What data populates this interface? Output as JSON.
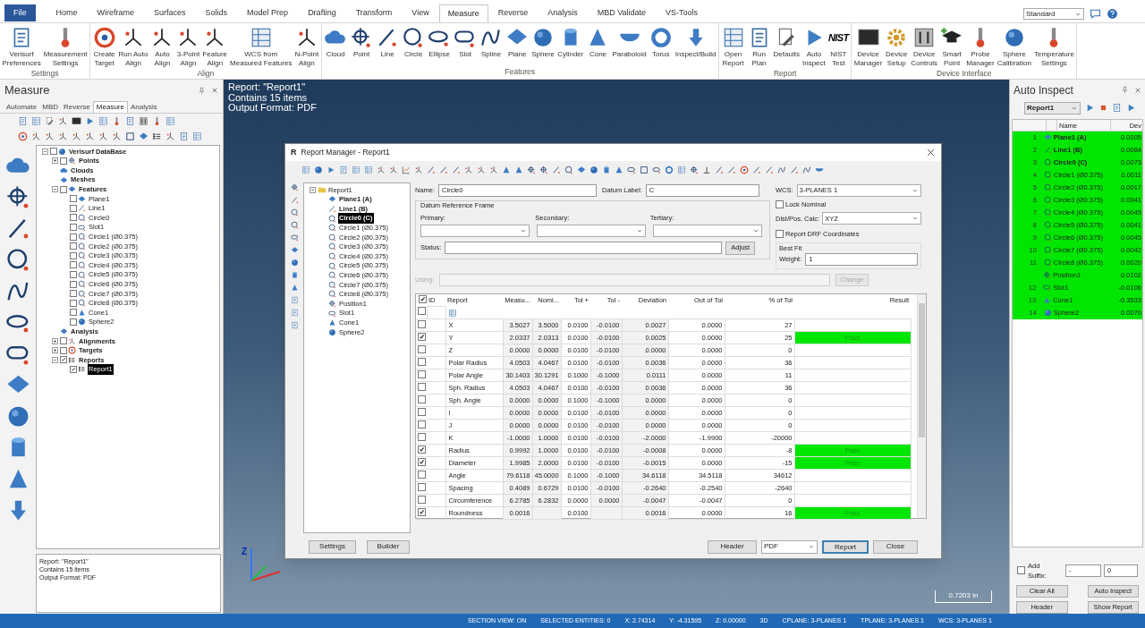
{
  "ribbon_tabs": [
    {
      "label": "File",
      "kind": "file",
      "selected": false
    },
    {
      "label": "Home",
      "kind": "tab",
      "selected": false
    },
    {
      "label": "Wireframe",
      "kind": "tab",
      "selected": false
    },
    {
      "label": "Surfaces",
      "kind": "tab",
      "selected": false
    },
    {
      "label": "Solids",
      "kind": "tab",
      "selected": false
    },
    {
      "label": "Model Prep",
      "kind": "tab",
      "selected": false
    },
    {
      "label": "Drafting",
      "kind": "tab",
      "selected": false
    },
    {
      "label": "Transform",
      "kind": "tab",
      "selected": false
    },
    {
      "label": "View",
      "kind": "tab",
      "selected": false
    },
    {
      "label": "Measure",
      "kind": "tab",
      "selected": true
    },
    {
      "label": "Reverse",
      "kind": "tab",
      "selected": false
    },
    {
      "label": "Analysis",
      "kind": "tab",
      "selected": false
    },
    {
      "label": "MBD Validate",
      "kind": "tab",
      "selected": false
    },
    {
      "label": "VS-Tools",
      "kind": "tab",
      "selected": false
    }
  ],
  "style_select": {
    "value": "Standard"
  },
  "ribbon_groups": [
    {
      "label": "Settings",
      "buttons": [
        {
          "label": "Verisurf\nPreferences"
        },
        {
          "label": "Measurement\nSettings"
        }
      ]
    },
    {
      "label": "Align",
      "buttons": [
        {
          "label": "Create\nTarget"
        },
        {
          "label": "Run Auto\nAlign"
        },
        {
          "label": "Auto\nAlign"
        },
        {
          "label": "3-Point\nAlign"
        },
        {
          "label": "Feature\nAlign"
        },
        {
          "label": "WCS from\nMeasured Features"
        },
        {
          "label": "N-Point\nAlign"
        }
      ]
    },
    {
      "label": "Features",
      "buttons": [
        {
          "label": "Cloud"
        },
        {
          "label": "Point"
        },
        {
          "label": "Line"
        },
        {
          "label": "Circle"
        },
        {
          "label": "Ellipse"
        },
        {
          "label": "Slot"
        },
        {
          "label": "Spline"
        },
        {
          "label": "Plane"
        },
        {
          "label": "Sphere"
        },
        {
          "label": "Cylinder"
        },
        {
          "label": "Cone"
        },
        {
          "label": "Paraboloid"
        },
        {
          "label": "Torus"
        },
        {
          "label": "Inspect/Build"
        }
      ]
    },
    {
      "label": "Report",
      "buttons": [
        {
          "label": "Open\nReport"
        },
        {
          "label": "Run\nPlan"
        },
        {
          "label": "Defaults"
        },
        {
          "label": "Auto\nInspect"
        },
        {
          "label": "NIST\nTest",
          "icon_text": "NIST"
        }
      ]
    },
    {
      "label": "Device Interface",
      "buttons": [
        {
          "label": "Device\nManager"
        },
        {
          "label": "Device\nSetup"
        },
        {
          "label": "Device\nControls"
        },
        {
          "label": "Smart\nPoint"
        },
        {
          "label": "Probe\nManager"
        },
        {
          "label": "Sphere\nCalibration"
        },
        {
          "label": "Temperature\nSettings"
        }
      ]
    }
  ],
  "measure_panel": {
    "title": "Measure",
    "tabs": [
      {
        "label": "Automate",
        "selected": false
      },
      {
        "label": "MBD",
        "selected": false
      },
      {
        "label": "Reverse",
        "selected": false
      },
      {
        "label": "Measure",
        "selected": true
      },
      {
        "label": "Analysis",
        "selected": false
      }
    ],
    "tree": [
      {
        "label": "Verisurf DataBase",
        "expanded": true,
        "checked": false,
        "selected": false,
        "children": [
          {
            "label": "Points",
            "expanded": false,
            "checked": false,
            "selected": false
          },
          {
            "label": "Clouds",
            "selected": false
          },
          {
            "label": "Meshes",
            "selected": false
          },
          {
            "label": "Features",
            "expanded": true,
            "checked": false,
            "selected": false,
            "children": [
              {
                "label": "Plane1",
                "checked": false,
                "selected": false
              },
              {
                "label": "Line1",
                "checked": false,
                "selected": false
              },
              {
                "label": "Circle0",
                "checked": false,
                "selected": false
              },
              {
                "label": "Slot1",
                "checked": false,
                "selected": false
              },
              {
                "label": "Circle1 (Ø0.375)",
                "checked": false,
                "selected": false
              },
              {
                "label": "Circle2 (Ø0.375)",
                "checked": false,
                "selected": false
              },
              {
                "label": "Circle3 (Ø0.375)",
                "checked": false,
                "selected": false
              },
              {
                "label": "Circle4 (Ø0.375)",
                "checked": false,
                "selected": false
              },
              {
                "label": "Circle5 (Ø0.375)",
                "checked": false,
                "selected": false
              },
              {
                "label": "Circle6 (Ø0.375)",
                "checked": false,
                "selected": false
              },
              {
                "label": "Circle7 (Ø0.375)",
                "checked": false,
                "selected": false
              },
              {
                "label": "Circle8 (Ø0.375)",
                "checked": false,
                "selected": false
              },
              {
                "label": "Cone1",
                "checked": false,
                "selected": false
              },
              {
                "label": "Sphere2",
                "checked": false,
                "selected": false
              }
            ]
          },
          {
            "label": "Analysis",
            "selected": false
          },
          {
            "label": "Alignments",
            "expanded": false,
            "checked": false,
            "selected": false
          },
          {
            "label": "Targets",
            "expanded": false,
            "checked": false,
            "selected": false
          },
          {
            "label": "Reports",
            "expanded": true,
            "checked": true,
            "selected": false,
            "children": [
              {
                "label": "Report1",
                "checked": true,
                "selected": true
              }
            ]
          }
        ]
      }
    ],
    "info": [
      "Report: \"Report1\"",
      "Contains 15 items",
      "Output Format: PDF"
    ]
  },
  "viewport": {
    "info": [
      "Report: \"Report1\"",
      "Contains 15 items",
      "Output Format: PDF"
    ],
    "triad_label": "Z",
    "scale": "0.7203 in"
  },
  "report_manager": {
    "title": "Report Manager - Report1",
    "logo": "R",
    "tree": {
      "label": "Report1",
      "expanded": true,
      "children": [
        {
          "label": "Plane1 (A)",
          "datum": true,
          "selected": false
        },
        {
          "label": "Line1 (B)",
          "datum": true,
          "selected": false
        },
        {
          "label": "Circle0 (C)",
          "datum": true,
          "selected": true
        },
        {
          "label": "Circle1 (Ø0.375)",
          "datum": false,
          "selected": false
        },
        {
          "label": "Circle2 (Ø0.375)",
          "datum": false,
          "selected": false
        },
        {
          "label": "Circle3 (Ø0.375)",
          "datum": false,
          "selected": false
        },
        {
          "label": "Circle4 (Ø0.375)",
          "datum": false,
          "selected": false
        },
        {
          "label": "Circle5 (Ø0.375)",
          "datum": false,
          "selected": false
        },
        {
          "label": "Circle6 (Ø0.375)",
          "datum": false,
          "selected": false
        },
        {
          "label": "Circle7 (Ø0.375)",
          "datum": false,
          "selected": false
        },
        {
          "label": "Circle8 (Ø0.375)",
          "datum": false,
          "selected": false
        },
        {
          "label": "Position1",
          "datum": false,
          "selected": false
        },
        {
          "label": "Slot1",
          "datum": false,
          "selected": false
        },
        {
          "label": "Cone1",
          "datum": false,
          "selected": false
        },
        {
          "label": "Sphere2",
          "datum": false,
          "selected": false
        }
      ]
    },
    "name": {
      "label": "Name:",
      "value": "Circle0"
    },
    "datum_label": {
      "label": "Datum Label:",
      "value": "C"
    },
    "wcs": {
      "label": "WCS:",
      "value": "3-PLANES 1"
    },
    "lock_nominal": {
      "label": "Lock Nominal",
      "checked": false
    },
    "drf": {
      "title": "Datum Reference Frame",
      "primary": "Primary:",
      "secondary": "Secondary:",
      "tertiary": "Tertiary:"
    },
    "status": {
      "label": "Status:",
      "button": "Adjust"
    },
    "dist_pos_calc": {
      "label": "Dist/Pos. Calc:",
      "value": "XYZ"
    },
    "report_drf": {
      "label": "Report DRF Coordinates",
      "checked": false
    },
    "best_fit": {
      "title": "Best Fit",
      "label": "Weight:",
      "value": "1"
    },
    "using": {
      "label": "Using:",
      "button": "Change",
      "disabled": true
    },
    "table": {
      "header_checked": true,
      "filter_checked": false,
      "columns": [
        "ID",
        "Report",
        "Measu...",
        "Nomi...",
        "Tol +",
        "Tol -",
        "Deviation",
        "Out of Tol",
        "% of Tol",
        "Result"
      ],
      "rows": [
        {
          "checked": false,
          "report": "X",
          "measured": "3.5027",
          "nominal": "3.5000",
          "tol_plus": "0.0100",
          "tol_minus": "-0.0100",
          "deviation": "0.0027",
          "out_of_tol": "0.0000",
          "pct": "27"
        },
        {
          "checked": true,
          "report": "Y",
          "measured": "2.0337",
          "nominal": "2.0313",
          "tol_plus": "0.0100",
          "tol_minus": "-0.0100",
          "deviation": "0.0025",
          "out_of_tol": "0.0000",
          "pct": "25",
          "result": "Pass"
        },
        {
          "checked": false,
          "report": "Z",
          "measured": "0.0000",
          "nominal": "0.0000",
          "tol_plus": "0.0100",
          "tol_minus": "-0.0100",
          "deviation": "0.0000",
          "out_of_tol": "0.0000",
          "pct": "0"
        },
        {
          "checked": false,
          "report": "Polar Radius",
          "measured": "4.0503",
          "nominal": "4.0467",
          "tol_plus": "0.0100",
          "tol_minus": "-0.0100",
          "deviation": "0.0036",
          "out_of_tol": "0.0000",
          "pct": "36"
        },
        {
          "checked": false,
          "report": "Polar Angle",
          "measured": "30.1403",
          "nominal": "30.1291",
          "tol_plus": "0.1000",
          "tol_minus": "-0.1000",
          "deviation": "0.0111",
          "out_of_tol": "0.0000",
          "pct": "11"
        },
        {
          "checked": false,
          "report": "Sph. Radius",
          "measured": "4.0503",
          "nominal": "4.0467",
          "tol_plus": "0.0100",
          "tol_minus": "-0.0100",
          "deviation": "0.0036",
          "out_of_tol": "0.0000",
          "pct": "36"
        },
        {
          "checked": false,
          "report": "Sph. Angle",
          "measured": "0.0000",
          "nominal": "0.0000",
          "tol_plus": "0.1000",
          "tol_minus": "-0.1000",
          "deviation": "0.0000",
          "out_of_tol": "0.0000",
          "pct": "0"
        },
        {
          "checked": false,
          "report": "I",
          "measured": "0.0000",
          "nominal": "0.0000",
          "tol_plus": "0.0100",
          "tol_minus": "-0.0100",
          "deviation": "0.0000",
          "out_of_tol": "0.0000",
          "pct": "0"
        },
        {
          "checked": false,
          "report": "J",
          "measured": "0.0000",
          "nominal": "0.0000",
          "tol_plus": "0.0100",
          "tol_minus": "-0.0100",
          "deviation": "0.0000",
          "out_of_tol": "0.0000",
          "pct": "0"
        },
        {
          "checked": false,
          "report": "K",
          "measured": "-1.0000",
          "nominal": "1.0000",
          "tol_plus": "0.0100",
          "tol_minus": "-0.0100",
          "deviation": "-2.0000",
          "out_of_tol": "-1.9900",
          "pct": "-20000"
        },
        {
          "checked": true,
          "report": "Radius",
          "measured": "0.9992",
          "nominal": "1.0000",
          "tol_plus": "0.0100",
          "tol_minus": "-0.0100",
          "deviation": "-0.0008",
          "out_of_tol": "0.0000",
          "pct": "-8",
          "result": "Pass"
        },
        {
          "checked": true,
          "report": "Diameter",
          "measured": "1.9985",
          "nominal": "2.0000",
          "tol_plus": "0.0100",
          "tol_minus": "-0.0100",
          "deviation": "-0.0015",
          "out_of_tol": "0.0000",
          "pct": "-15",
          "result": "Pass"
        },
        {
          "checked": false,
          "report": "Angle",
          "measured": "79.6118",
          "nominal": "45.0000",
          "tol_plus": "0.1000",
          "tol_minus": "-0.1000",
          "deviation": "34.6118",
          "out_of_tol": "34.5118",
          "pct": "34612"
        },
        {
          "checked": false,
          "report": "Spacing",
          "measured": "0.4089",
          "nominal": "0.6729",
          "tol_plus": "0.0100",
          "tol_minus": "-0.0100",
          "deviation": "-0.2640",
          "out_of_tol": "-0.2540",
          "pct": "-2640"
        },
        {
          "checked": false,
          "report": "Circumference",
          "measured": "6.2785",
          "nominal": "6.2832",
          "tol_plus": "0.0000",
          "tol_minus": "0.0000",
          "deviation": "-0.0047",
          "out_of_tol": "-0.0047",
          "pct": "0"
        },
        {
          "checked": true,
          "report": "Roundness",
          "measured": "0.0016",
          "tol_plus": "0.0100",
          "deviation": "0.0016",
          "out_of_tol": "0.0000",
          "pct": "16",
          "result": "Pass"
        }
      ]
    },
    "buttons": {
      "settings": "Settings",
      "builder": "Builder",
      "header": "Header",
      "format": "PDF",
      "report": "Report",
      "close": "Close"
    }
  },
  "auto_inspect": {
    "title": "Auto Inspect",
    "report": "Report1",
    "columns": [
      "Name",
      "Dev"
    ],
    "rows": [
      {
        "id": "1",
        "name": "Plane1 (A)",
        "dev": "0.0005",
        "datum": true
      },
      {
        "id": "2",
        "name": "Line1 (B)",
        "dev": "0.0084",
        "datum": true
      },
      {
        "id": "3",
        "name": "Circle0 (C)",
        "dev": "0.0073",
        "datum": true
      },
      {
        "id": "4",
        "name": "Circle1 (Ø0.375)",
        "dev": "0.0011",
        "datum": false
      },
      {
        "id": "5",
        "name": "Circle2 (Ø0.375)",
        "dev": "0.0017",
        "datum": false
      },
      {
        "id": "6",
        "name": "Circle3 (Ø0.375)",
        "dev": "0.0041",
        "datum": false
      },
      {
        "id": "7",
        "name": "Circle4 (Ø0.375)",
        "dev": "0.0045",
        "datum": false
      },
      {
        "id": "8",
        "name": "Circle5 (Ø0.375)",
        "dev": "0.0041",
        "datum": false
      },
      {
        "id": "9",
        "name": "Circle6 (Ø0.375)",
        "dev": "0.0045",
        "datum": false
      },
      {
        "id": "10",
        "name": "Circle7 (Ø0.375)",
        "dev": "0.0042",
        "datum": false
      },
      {
        "id": "11",
        "name": "Circle8 (Ø0.375)",
        "dev": "0.0020",
        "datum": false
      },
      {
        "name": "Position1",
        "dev": "0.0102",
        "datum": false
      },
      {
        "id": "12",
        "name": "Slot1",
        "dev": "-0.0106",
        "datum": false
      },
      {
        "id": "13",
        "name": "Cone1",
        "dev": "-0.3533",
        "datum": false
      },
      {
        "id": "14",
        "name": "Sphere2",
        "dev": "0.0070",
        "datum": false
      }
    ],
    "add_suffix": {
      "label": "Add Suffix:",
      "checked": false,
      "separator": "-",
      "start": "0"
    },
    "buttons": [
      "Clear All",
      "Auto Inspect",
      "Header",
      "Show Report"
    ]
  },
  "status_bar": [
    "SECTION VIEW: ON",
    "SELECTED ENTITIES: 0",
    "X: 2.74314",
    "Y: -4.31595",
    "Z: 0.00000",
    "3D",
    "CPLANE: 3-PLANES 1",
    "TPLANE: 3-PLANES 1",
    "WCS: 3-PLANES 1"
  ]
}
